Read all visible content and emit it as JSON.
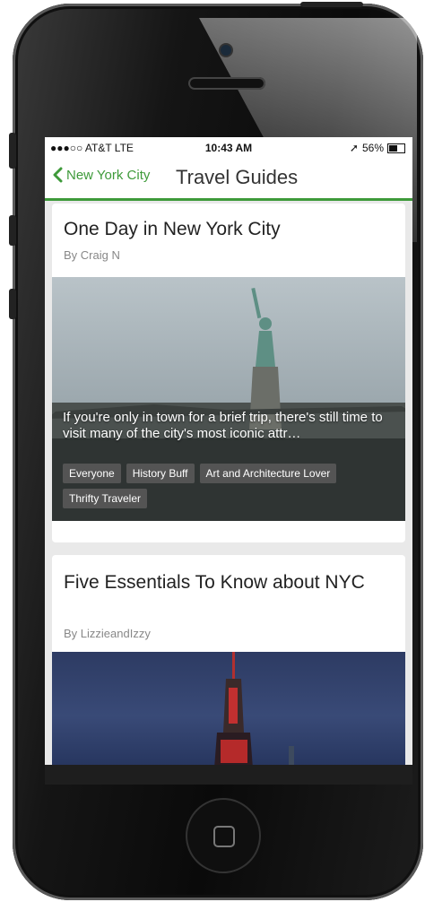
{
  "status_bar": {
    "carrier": "●●●○○ AT&T  LTE",
    "time": "10:43 AM",
    "battery": "56%"
  },
  "nav": {
    "back_label": "New York City",
    "title": "Travel Guides"
  },
  "cards": [
    {
      "title": "One Day in New York City",
      "author": "By Craig N",
      "description": "If you're only in town for a brief trip, there's still time to visit many of the city's most iconic attr…",
      "tags": [
        "Everyone",
        "History Buff",
        "Art and Architecture Lover",
        "Thrifty Traveler"
      ]
    },
    {
      "title": "Five Essentials To Know about NYC",
      "author": "By LizzieandIzzy"
    }
  ],
  "colors": {
    "accent": "#3e9a3a"
  }
}
